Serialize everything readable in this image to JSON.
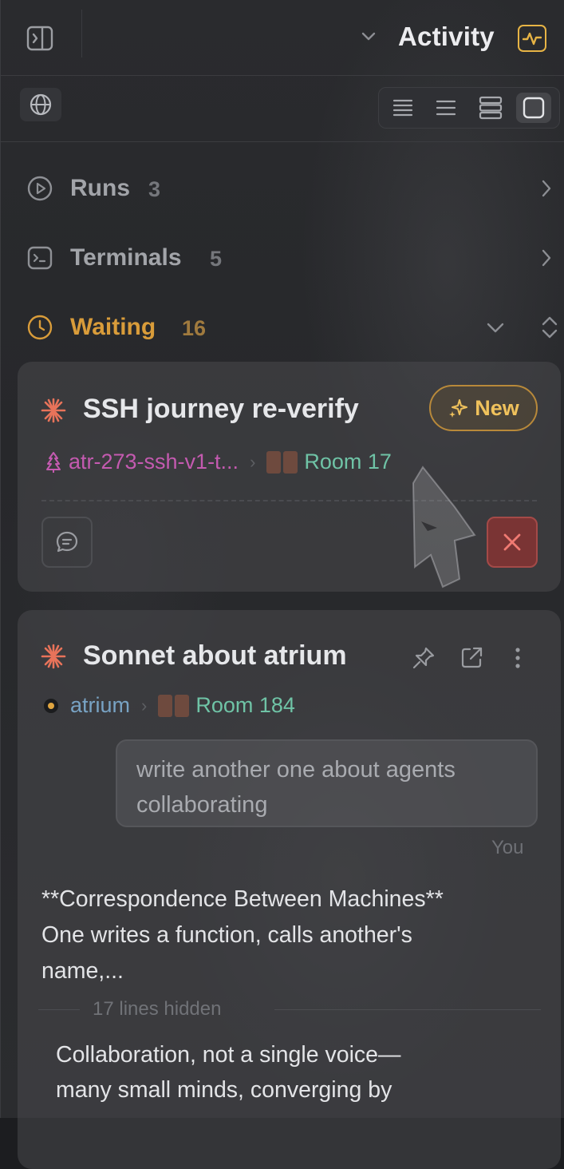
{
  "header": {
    "title": "Activity"
  },
  "toolbar": {
    "view_modes": [
      "compact-lines-icon",
      "list-lines-icon",
      "stacked-rows-icon",
      "card-view-icon"
    ],
    "active_view": "card-view-icon"
  },
  "sections": {
    "runs": {
      "label": "Runs",
      "count": "3"
    },
    "terminals": {
      "label": "Terminals",
      "count": "5"
    },
    "waiting": {
      "label": "Waiting",
      "count": "16"
    }
  },
  "cards": [
    {
      "title": "SSH journey re-verify",
      "badge": "New",
      "branch": "atr-273-ssh-v1-t...",
      "room": "Room 17"
    },
    {
      "title": "Sonnet about atrium",
      "repo": "atrium",
      "room": "Room 184",
      "user_message": "write another one about agents collaborating",
      "sender": "You",
      "reply_line1": "**Correspondence Between Machines**",
      "reply_line2": "One writes a function, calls another's",
      "reply_line3": "name,...",
      "hidden_note": "17 lines hidden",
      "reply2_line1": "Collaboration, not a single voice—",
      "reply2_line2": "many small minds, converging by"
    }
  ],
  "colors": {
    "accent": "#e7b445",
    "waiting": "#d99c3a",
    "branch": "#c45ab0",
    "room": "#6fc3a6",
    "repo": "#78a3c4",
    "danger": "#7a3434",
    "star": "#e8735a"
  }
}
